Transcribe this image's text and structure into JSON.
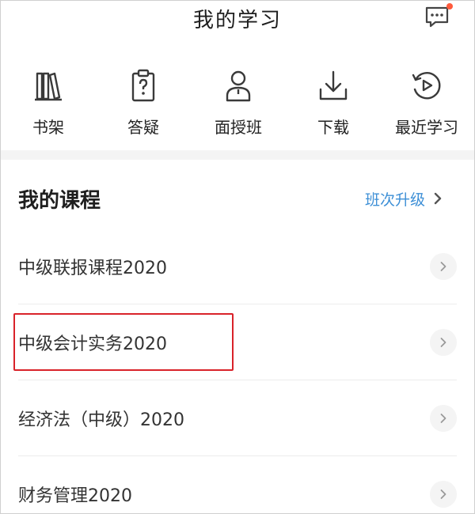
{
  "header": {
    "title": "我的学习",
    "message_icon": "message-bubble-icon",
    "badge_color": "#ff5a3c"
  },
  "quick_nav": [
    {
      "label": "书架",
      "icon": "bookshelf-icon"
    },
    {
      "label": "答疑",
      "icon": "clipboard-question-icon"
    },
    {
      "label": "面授班",
      "icon": "person-icon"
    },
    {
      "label": "下载",
      "icon": "download-icon"
    },
    {
      "label": "最近学习",
      "icon": "recent-play-icon"
    }
  ],
  "courses": {
    "title": "我的课程",
    "upgrade_label": "班次升级",
    "link_color": "#3d8fd6",
    "items": [
      {
        "label": "中级联报课程2020"
      },
      {
        "label": "中级会计实务2020"
      },
      {
        "label": "经济法（中级）2020"
      },
      {
        "label": "财务管理2020"
      }
    ]
  },
  "highlight_color": "#d9222a"
}
